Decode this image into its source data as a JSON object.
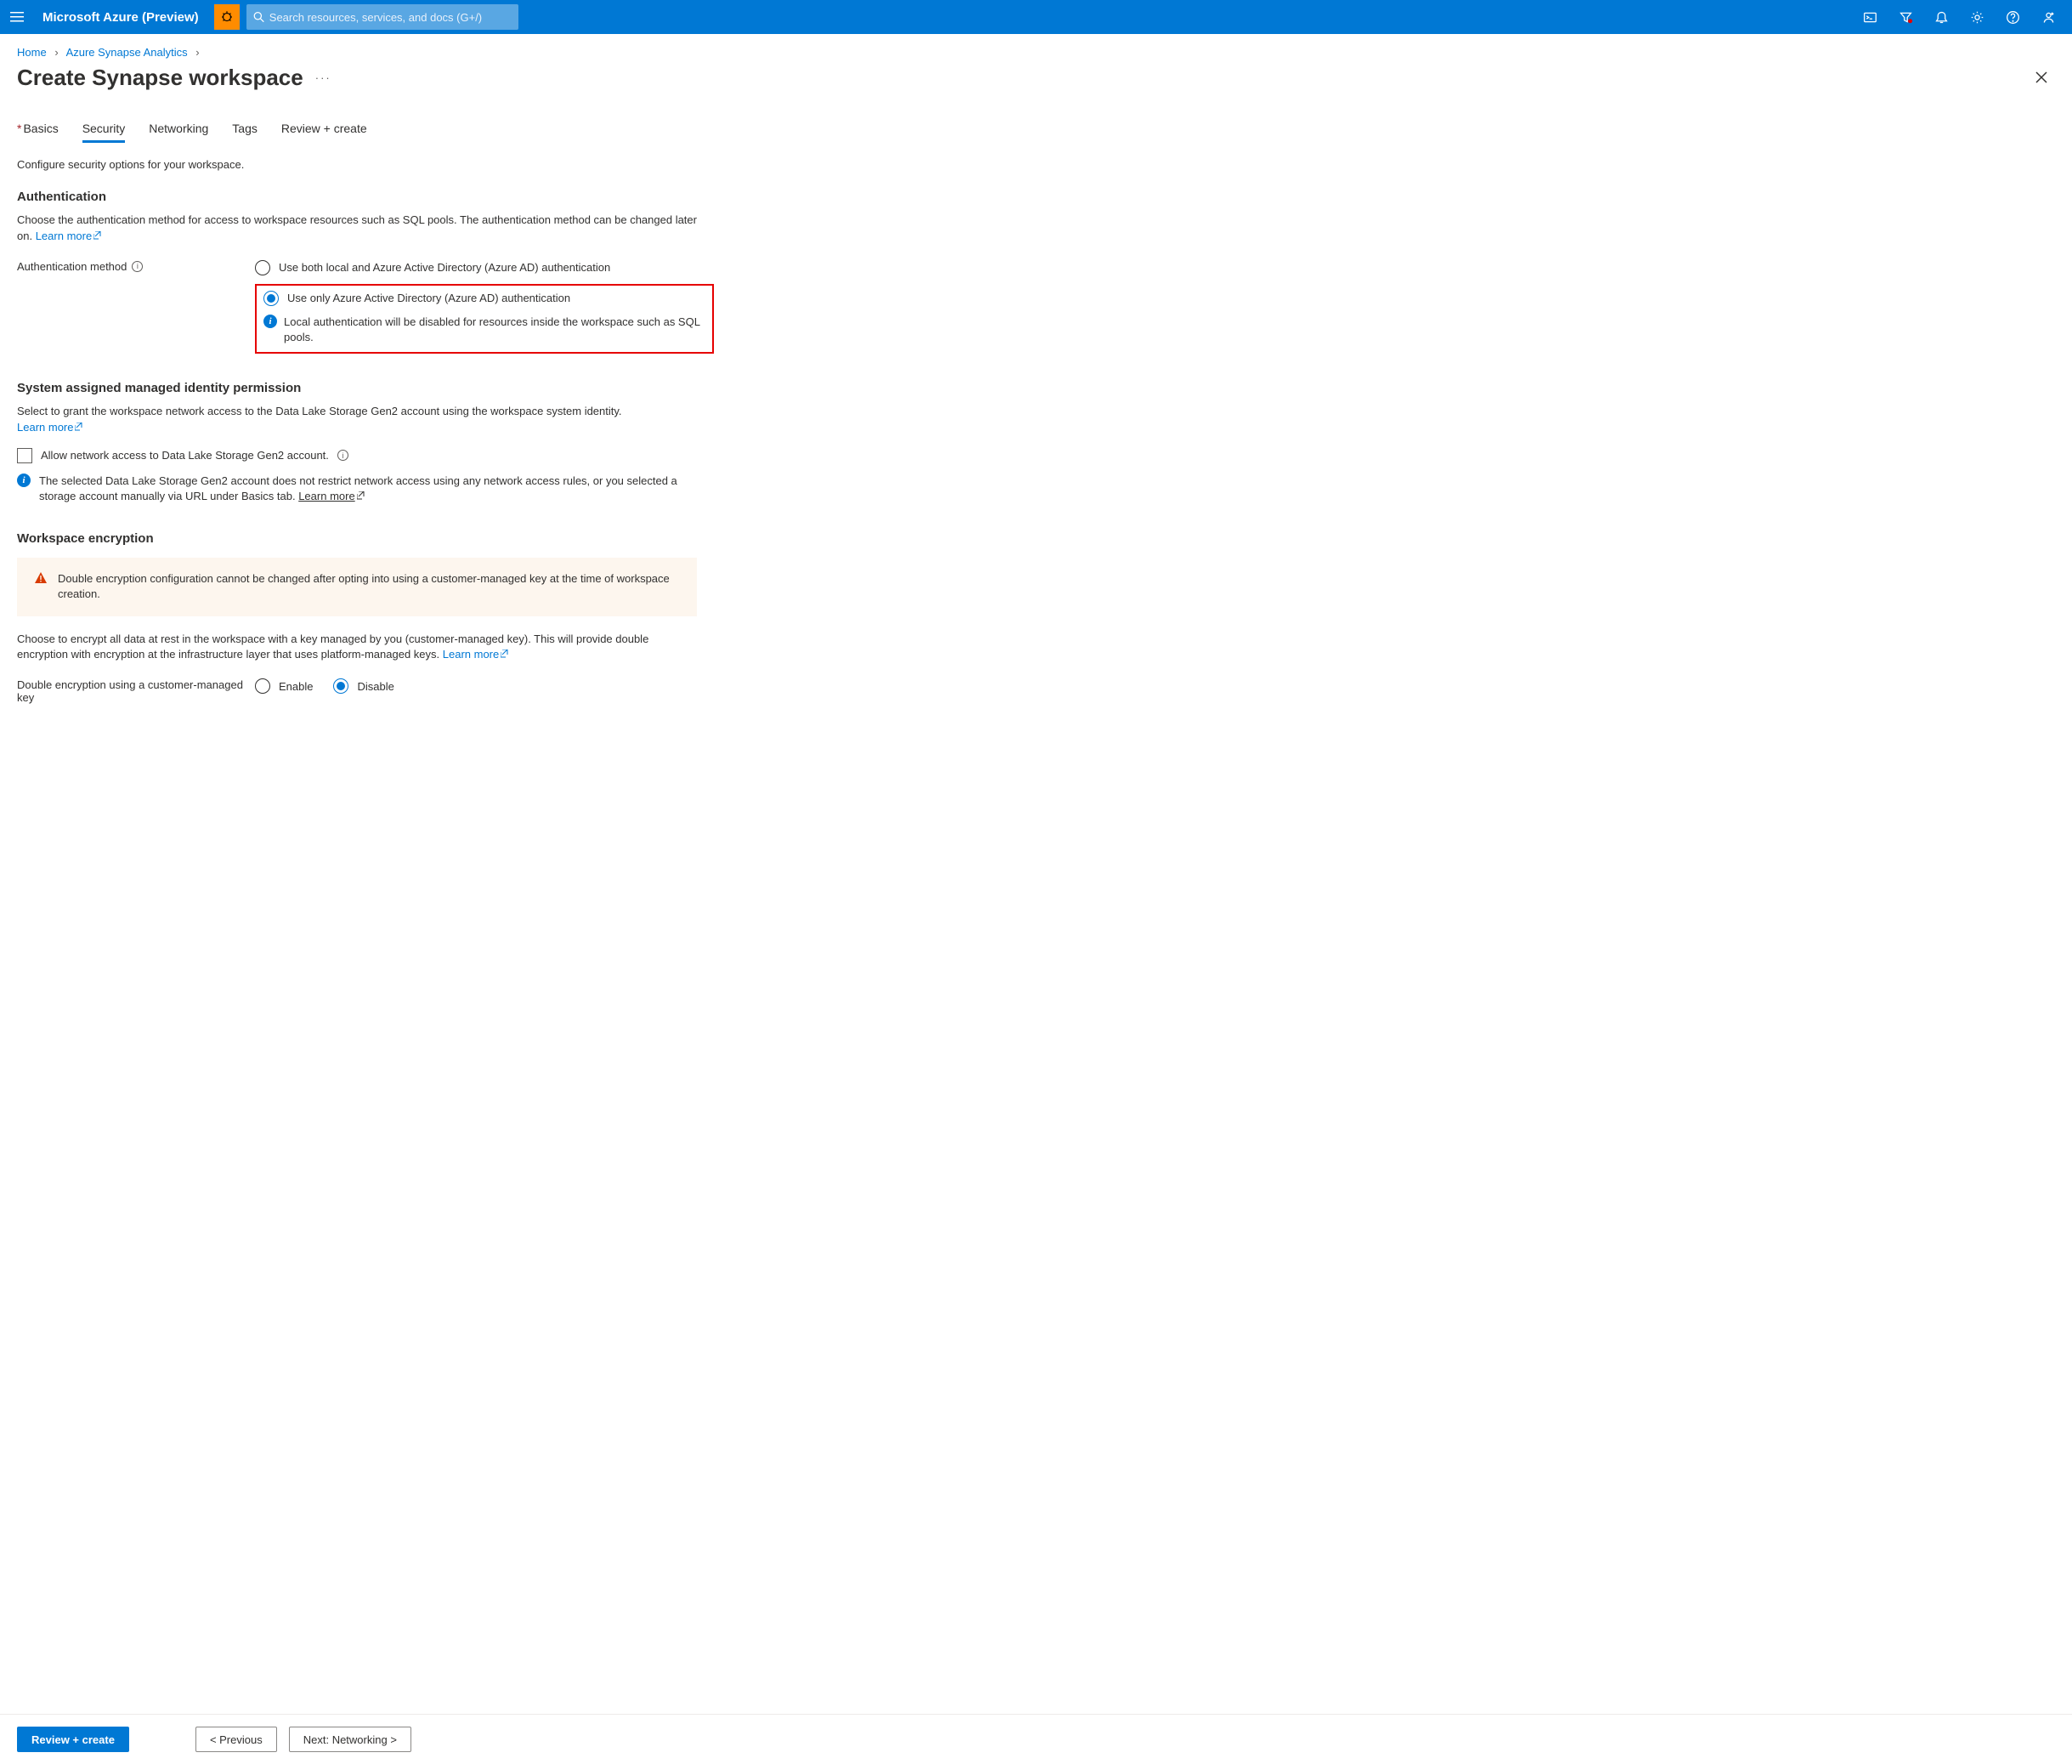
{
  "topbar": {
    "brand": "Microsoft Azure (Preview)",
    "search_placeholder": "Search resources, services, and docs (G+/)"
  },
  "breadcrumb": {
    "home": "Home",
    "item": "Azure Synapse Analytics"
  },
  "page_title": "Create Synapse workspace",
  "tabs": {
    "basics": "Basics",
    "security": "Security",
    "networking": "Networking",
    "tags": "Tags",
    "review": "Review + create"
  },
  "intro": "Configure security options for your workspace.",
  "auth": {
    "heading": "Authentication",
    "desc": "Choose the authentication method for access to workspace resources such as SQL pools. The authentication method can be changed later on.",
    "learn_more": "Learn more",
    "field_label": "Authentication method",
    "opt_both": "Use both local and Azure Active Directory (Azure AD) authentication",
    "opt_aad": "Use only Azure Active Directory (Azure AD) authentication",
    "info": "Local authentication will be disabled for resources inside the workspace such as SQL pools."
  },
  "smi": {
    "heading": "System assigned managed identity permission",
    "desc": "Select to grant the workspace network access to the Data Lake Storage Gen2 account using the workspace system identity.",
    "learn_more": "Learn more",
    "checkbox_label": "Allow network access to Data Lake Storage Gen2 account.",
    "info_text": "The selected Data Lake Storage Gen2 account does not restrict network access using any network access rules, or you selected a storage account manually via URL under Basics tab.",
    "info_link": "Learn more"
  },
  "enc": {
    "heading": "Workspace encryption",
    "warn": "Double encryption configuration cannot be changed after opting into using a customer-managed key at the time of workspace creation.",
    "desc": "Choose to encrypt all data at rest in the workspace with a key managed by you (customer-managed key). This will provide double encryption with encryption at the infrastructure layer that uses platform-managed keys.",
    "learn_more": "Learn more",
    "field_label": "Double encryption using a customer-managed key",
    "enable": "Enable",
    "disable": "Disable"
  },
  "footer": {
    "review": "Review + create",
    "previous": "< Previous",
    "next": "Next: Networking >"
  }
}
